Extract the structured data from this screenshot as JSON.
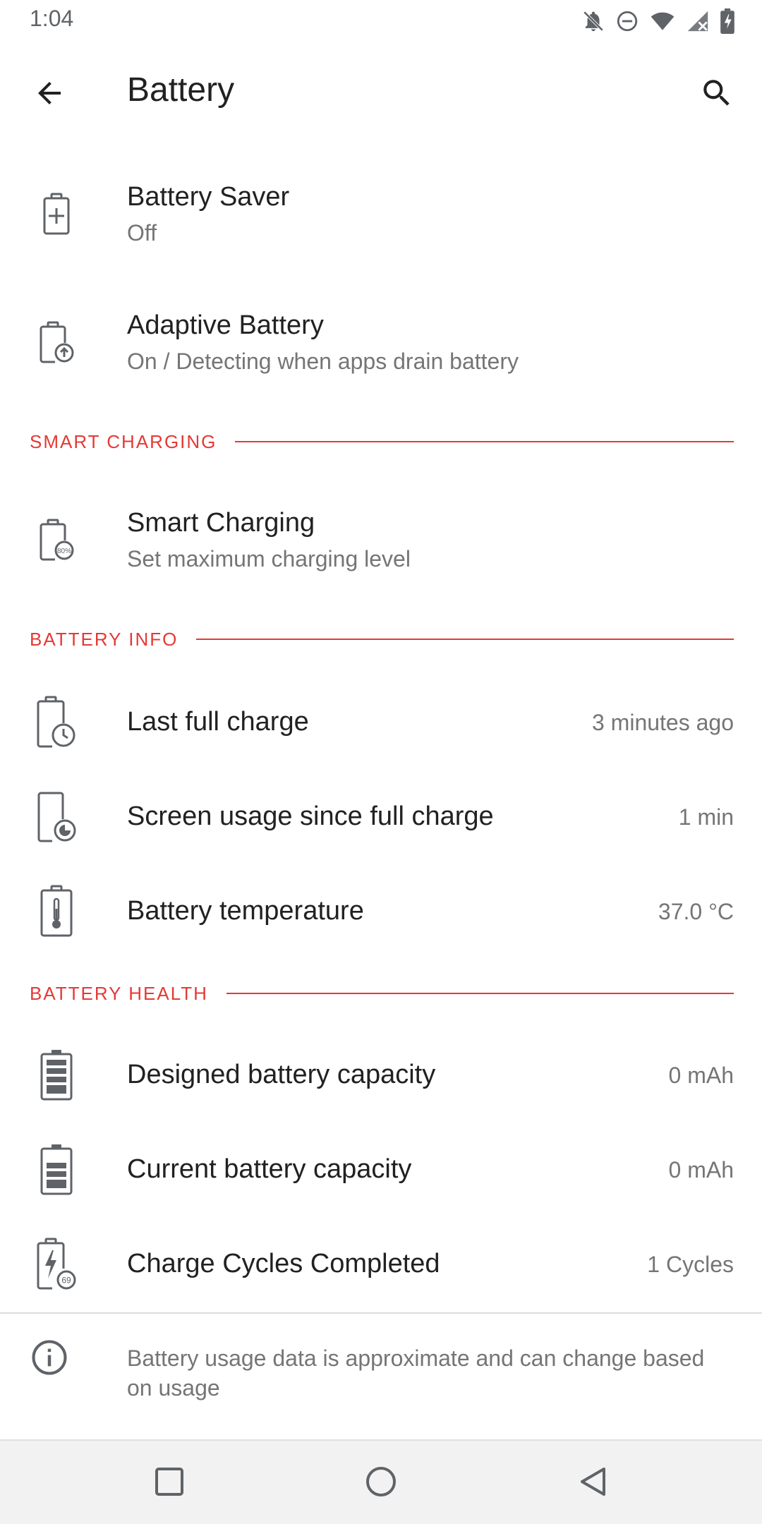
{
  "status_bar": {
    "time": "1:04",
    "icons": [
      "notifications-off-icon",
      "do-not-disturb-icon",
      "wifi-icon",
      "signal-icon",
      "battery-icon"
    ]
  },
  "app_bar": {
    "title": "Battery",
    "back_icon": "arrow-back-icon",
    "search_icon": "search-icon"
  },
  "items": {
    "battery_saver": {
      "title": "Battery Saver",
      "summary": "Off",
      "icon": "battery-plus-icon"
    },
    "adaptive_battery": {
      "title": "Adaptive Battery",
      "summary": "On / Detecting when apps drain battery",
      "icon": "battery-adaptive-icon"
    }
  },
  "sections": {
    "smart_charging": {
      "header": "SMART CHARGING",
      "item": {
        "title": "Smart Charging",
        "summary": "Set maximum charging level",
        "icon": "battery-80-icon",
        "icon_text": "80%"
      }
    },
    "battery_info": {
      "header": "BATTERY INFO",
      "items": [
        {
          "title": "Last full charge",
          "value": "3 minutes ago",
          "icon": "battery-clock-icon"
        },
        {
          "title": "Screen usage since full charge",
          "value": "1 min",
          "icon": "screen-usage-icon"
        },
        {
          "title": "Battery temperature",
          "value": "37.0 °C",
          "icon": "battery-thermometer-icon"
        }
      ]
    },
    "battery_health": {
      "header": "BATTERY HEALTH",
      "items": [
        {
          "title": "Designed battery capacity",
          "value": "0 mAh",
          "icon": "battery-full-icon"
        },
        {
          "title": "Current battery capacity",
          "value": "0 mAh",
          "icon": "battery-partial-icon"
        },
        {
          "title": "Charge Cycles Completed",
          "value": "1 Cycles",
          "icon": "battery-cycles-icon",
          "icon_text": "69"
        }
      ]
    }
  },
  "footer": {
    "text": "Battery usage data is approximate and can change based on usage",
    "icon": "info-icon"
  },
  "nav_bar": {
    "buttons": [
      "recents-button",
      "home-button",
      "back-button"
    ]
  },
  "colors": {
    "accent": "#e53935",
    "text_primary": "#212121",
    "text_secondary": "#757575",
    "icon": "#5f6368"
  }
}
